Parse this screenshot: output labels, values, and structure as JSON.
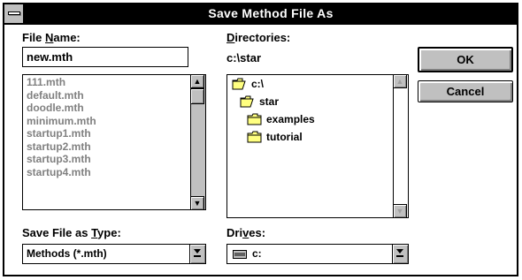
{
  "window": {
    "title": "Save Method File As"
  },
  "file_name": {
    "label_pre": "File ",
    "label_hot": "N",
    "label_post": "ame:",
    "value": "new.mth"
  },
  "files": [
    "111.mth",
    "default.mth",
    "doodle.mth",
    "minimum.mth",
    "startup1.mth",
    "startup2.mth",
    "startup3.mth",
    "startup4.mth"
  ],
  "directories": {
    "label_hot": "D",
    "label_post": "irectories:",
    "current": "c:\\star",
    "items": [
      {
        "name": "c:\\",
        "icon": "open-folder-icon"
      },
      {
        "name": "star",
        "icon": "open-folder-icon"
      },
      {
        "name": "examples",
        "icon": "folder-icon"
      },
      {
        "name": "tutorial",
        "icon": "folder-icon"
      }
    ]
  },
  "save_type": {
    "label_pre": "Save File as ",
    "label_hot": "T",
    "label_post": "ype:",
    "value": "Methods (*.mth)"
  },
  "drives": {
    "label_pre": "Dri",
    "label_hot": "v",
    "label_post": "es:",
    "value": "c:"
  },
  "buttons": {
    "ok": "OK",
    "cancel": "Cancel"
  },
  "icons": {
    "scroll_up": "up-arrow-icon",
    "scroll_down": "down-arrow-icon",
    "drive": "hard-drive-icon",
    "system_menu": "system-menu-icon"
  }
}
